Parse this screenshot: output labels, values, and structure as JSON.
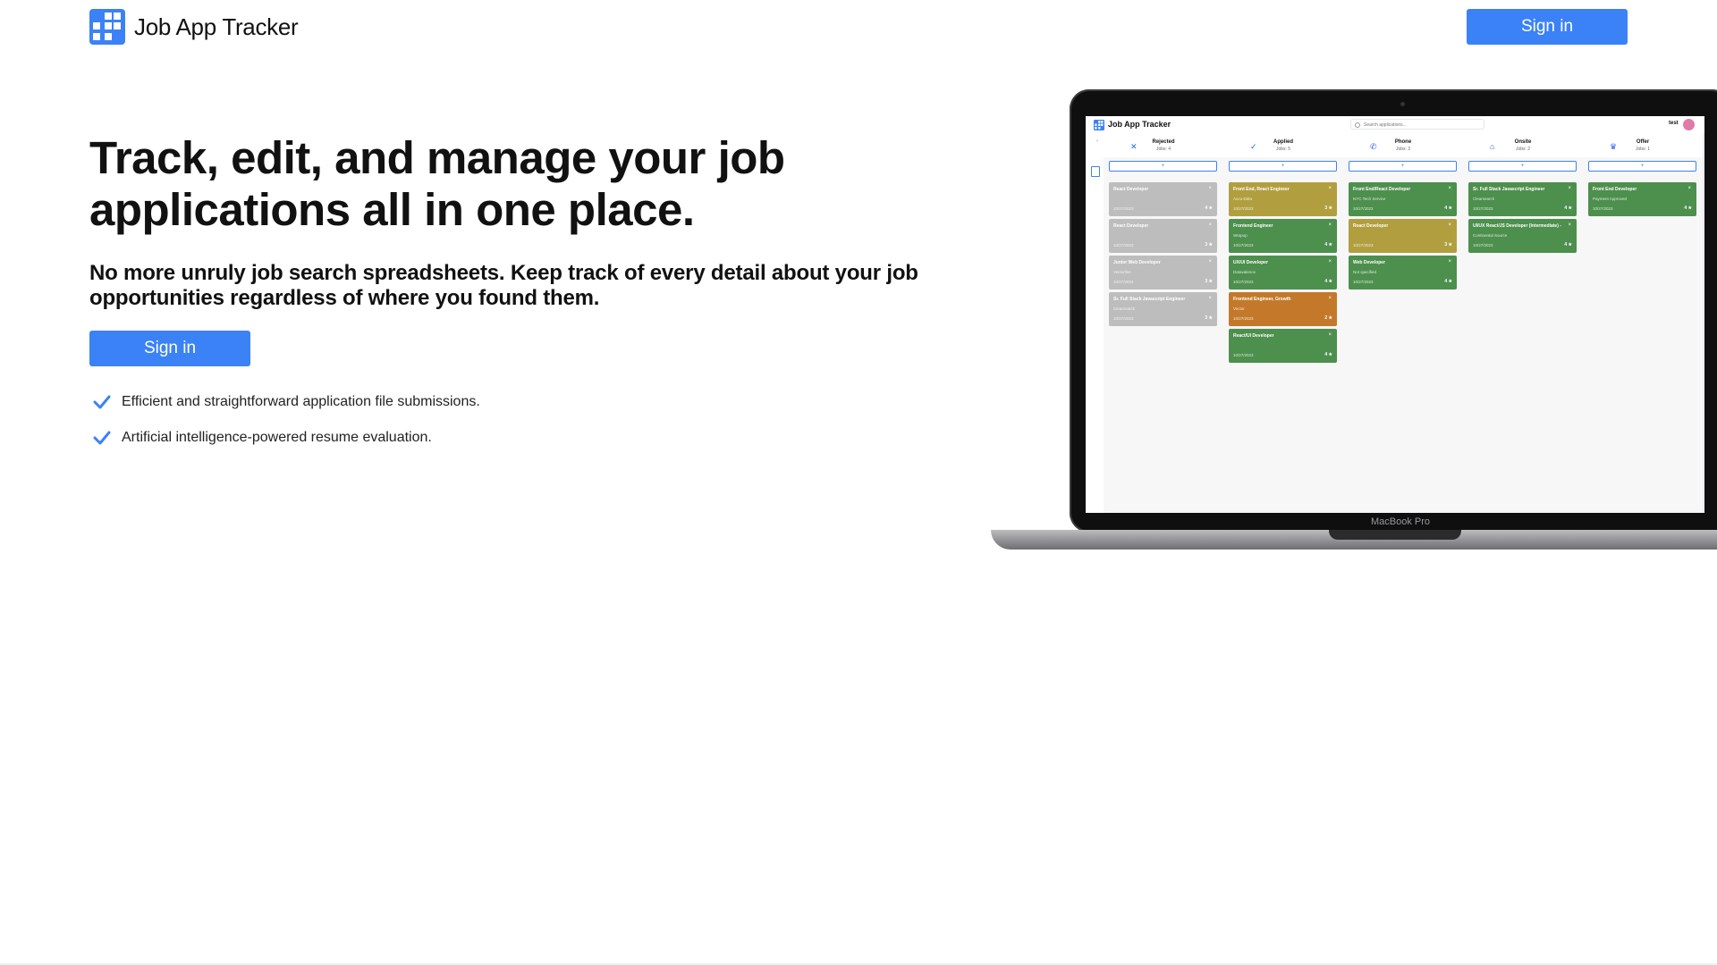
{
  "header": {
    "app_name": "Job App Tracker",
    "sign_in_label": "Sign in"
  },
  "hero": {
    "headline": "Track, edit, and manage your job applications all in one place.",
    "subheadline": "No more unruly job search spreadsheets. Keep track of every detail about your job opportunities regardless of where you found them.",
    "sign_in_label": "Sign in",
    "features": [
      "Efficient and straightforward application file submissions.",
      "Artificial intelligence-powered resume evaluation."
    ]
  },
  "laptop": {
    "model_label": "MacBook Pro",
    "app": {
      "title": "Job App Tracker",
      "search_placeholder": "Search applications...",
      "user": "test",
      "columns": [
        {
          "title": "Rejected",
          "count": "Jobs: 4",
          "icon": "close-icon",
          "color": "#2563eb"
        },
        {
          "title": "Applied",
          "count": "Jobs: 5",
          "icon": "check-icon",
          "color": "#2563eb"
        },
        {
          "title": "Phone",
          "count": "Jobs: 3",
          "icon": "phone-icon",
          "color": "#2563eb"
        },
        {
          "title": "Onsite",
          "count": "Jobs: 2",
          "icon": "home-icon",
          "color": "#2563eb"
        },
        {
          "title": "Offer",
          "count": "Jobs: 1",
          "icon": "trophy-icon",
          "color": "#2563eb"
        }
      ],
      "cards": [
        [
          {
            "title": "React Developer",
            "company": "",
            "date": "10/27/2023",
            "rating": "4",
            "color": "gray"
          },
          {
            "title": "React Developer",
            "company": "",
            "date": "10/27/2023",
            "rating": "3",
            "color": "gray"
          },
          {
            "title": "Junior Web Developer",
            "company": "Vectorline",
            "date": "10/27/2023",
            "rating": "3",
            "color": "gray"
          },
          {
            "title": "Sr. Full Stack Javascript Engineer",
            "company": "Clearsearch",
            "date": "10/27/2023",
            "rating": "3",
            "color": "gray"
          }
        ],
        [
          {
            "title": "Front End, React Engineer",
            "company": "Accu-Data",
            "date": "10/27/2023",
            "rating": "3",
            "color": "olive"
          },
          {
            "title": "Frontend Engineer",
            "company": "Wrapup",
            "date": "10/27/2023",
            "rating": "4",
            "color": "green"
          },
          {
            "title": "UX/UI Developer",
            "company": "Datavalence",
            "date": "10/27/2023",
            "rating": "4",
            "color": "green"
          },
          {
            "title": "Frontend Engineer, Growth",
            "company": "Vector",
            "date": "10/27/2023",
            "rating": "2",
            "color": "orange"
          },
          {
            "title": "React/UI Developer",
            "company": "",
            "date": "10/27/2023",
            "rating": "4",
            "color": "green"
          }
        ],
        [
          {
            "title": "Front End/React Developer",
            "company": "NYC Tech Service",
            "date": "10/27/2023",
            "rating": "4",
            "color": "green"
          },
          {
            "title": "React Developer",
            "company": "",
            "date": "10/27/2023",
            "rating": "3",
            "color": "olive"
          },
          {
            "title": "Web Developer",
            "company": "Not specified",
            "date": "10/27/2023",
            "rating": "4",
            "color": "green"
          }
        ],
        [
          {
            "title": "Sr. Full Stack Javascript Engineer",
            "company": "Clearsearch",
            "date": "10/27/2023",
            "rating": "4",
            "color": "green"
          },
          {
            "title": "UI/UX React/JS Developer (Intermediate) - Remote",
            "company": "Continental Source",
            "date": "10/27/2023",
            "rating": "4",
            "color": "green"
          }
        ],
        [
          {
            "title": "Front End Developer",
            "company": "Payment Approved",
            "date": "10/27/2023",
            "rating": "4",
            "color": "green"
          }
        ]
      ]
    }
  },
  "colors": {
    "primary": "#3b82f6",
    "card_green": "#4d8f4d",
    "card_gray": "#bdbdbd",
    "card_olive": "#b19f3f",
    "card_orange": "#c4792a"
  }
}
